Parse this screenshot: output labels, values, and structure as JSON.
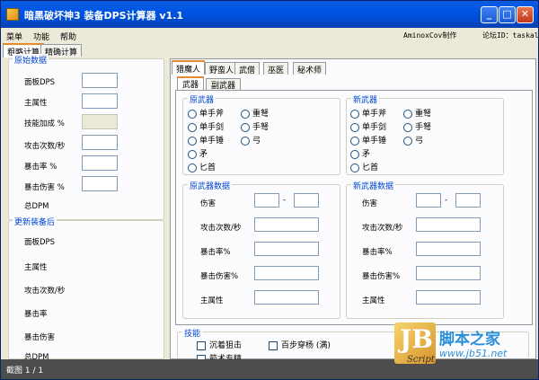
{
  "window": {
    "title": "暗黑破坏神3 装备DPS计算器 v1.1",
    "min": "_",
    "max": "□",
    "close": "✕"
  },
  "menu": {
    "items": [
      "菜单",
      "功能",
      "帮助"
    ],
    "credit": "AminoxCov制作",
    "forum_id": "论坛ID：taskal"
  },
  "outer_tabs": [
    "粗略计算",
    "精确计算"
  ],
  "left": {
    "group1_title": "原始数据",
    "fields": [
      "面板DPS",
      "主属性",
      "技能加成 %",
      "攻击次数/秒",
      "暴击率 %",
      "暴击伤害 %",
      "总DPM"
    ],
    "group2_title": "更新装备后",
    "fields2": [
      "面板DPS",
      "主属性",
      "攻击次数/秒",
      "暴击率",
      "暴击伤害",
      "总DPM"
    ]
  },
  "class_tabs": [
    "猎魔人",
    "野蛮人",
    "武僧",
    "巫医",
    "秘术师"
  ],
  "weapon_tabs": [
    "武器",
    "副武器"
  ],
  "orig_weapon": {
    "title": "原武器",
    "options_col1": [
      "单手斧",
      "单手剑",
      "单手锤",
      "矛",
      "匕首"
    ],
    "options_col2": [
      "重弩",
      "手弩",
      "弓"
    ]
  },
  "new_weapon": {
    "title": "新武器",
    "options_col1": [
      "单手斧",
      "单手剑",
      "单手锤",
      "矛",
      "匕首"
    ],
    "options_col2": [
      "重弩",
      "手弩",
      "弓"
    ]
  },
  "orig_weapon_data": {
    "title": "原武器数据",
    "fields": [
      "伤害",
      "攻击次数/秒",
      "暴击率%",
      "暴击伤害%",
      "主属性"
    ],
    "dash": "-"
  },
  "new_weapon_data": {
    "title": "新武器数据",
    "fields": [
      "伤害",
      "攻击次数/秒",
      "暴击率%",
      "暴击伤害%",
      "主属性"
    ],
    "dash": "-"
  },
  "skills": {
    "title": "技能",
    "items": [
      "沉着狙击",
      "百步穿杨 (满)",
      "箭术专精"
    ]
  },
  "status": {
    "text": "截图 1 / 1"
  },
  "watermark": {
    "logo": "JB",
    "script": "Script",
    "site_cn": "脚本之家",
    "url": "www.jb51.net"
  }
}
